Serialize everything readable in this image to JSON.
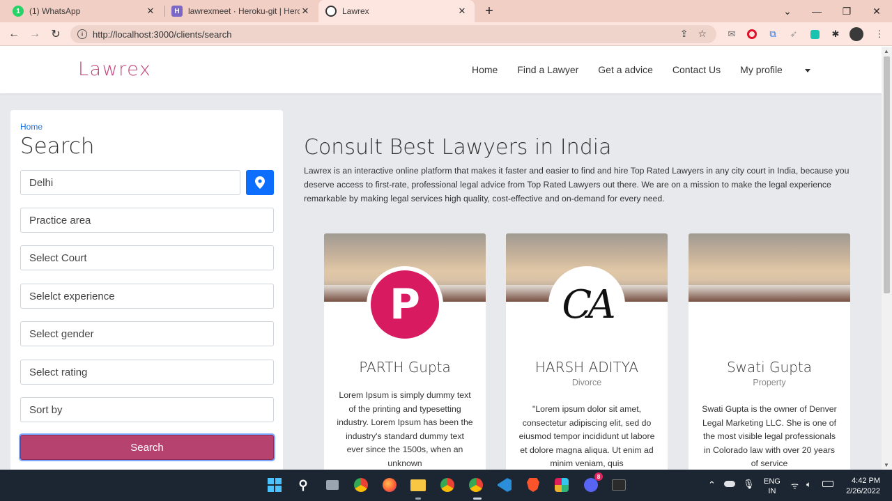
{
  "browser": {
    "tabs": [
      {
        "title": "(1) WhatsApp",
        "icon": "whatsapp-icon",
        "active": false
      },
      {
        "title": "lawrexmeet · Heroku-git | Heroku",
        "icon": "heroku-icon",
        "active": false
      },
      {
        "title": "Lawrex",
        "icon": "globe-icon",
        "active": true
      }
    ],
    "new_tab": "+",
    "url": "http://localhost:3000/clients/search"
  },
  "navbar": {
    "brand": "Lawrex",
    "links": [
      "Home",
      "Find a Lawyer",
      "Get a advice",
      "Contact Us",
      "My profile"
    ]
  },
  "search_panel": {
    "breadcrumb": "Home",
    "title": "Search",
    "location_value": "Delhi",
    "fields": [
      "Practice area",
      "Select Court",
      "Selelct experience",
      "Select gender",
      "Select rating",
      "Sort by"
    ],
    "search_label": "Search"
  },
  "hero": {
    "title": "Consult Best Lawyers in India",
    "text": "Lawrex is an interactive online platform that makes it faster and easier to find and hire Top Rated Lawyers in any city court in India, because you deserve access to first-rate, professional legal advice from Top Rated Lawyers out there. We are on a mission to make the legal experience remarkable by making legal services high quality, cost-effective and on-demand for every need."
  },
  "lawyers": [
    {
      "name": "PARTH Gupta",
      "role": "",
      "avatar_letter": "P",
      "description": "Lorem Ipsum is simply dummy text of the printing and typesetting industry. Lorem Ipsum has been the industry's standard dummy text ever since the 1500s, when an unknown"
    },
    {
      "name": "HARSH ADITYA",
      "role": "Divorce",
      "avatar_letter": "CA",
      "description": "\"Lorem ipsum dolor sit amet, consectetur adipiscing elit, sed do eiusmod tempor incididunt ut labore et dolore magna aliqua. Ut enim ad minim veniam, quis"
    },
    {
      "name": "Swati Gupta",
      "role": "Property",
      "avatar_letter": "",
      "description": "Swati Gupta is the owner of Denver Legal Marketing LLC. She is one of the most visible legal professionals in Colorado law with over 20 years of service"
    }
  ],
  "taskbar": {
    "language": "ENG",
    "region": "IN",
    "time": "4:42 PM",
    "date": "2/26/2022",
    "discord_badge": "8"
  },
  "colors": {
    "brand": "#c0467a",
    "search_button": "#b6426f",
    "location_button": "#0d6efd",
    "avatar_p": "#d81b60"
  }
}
